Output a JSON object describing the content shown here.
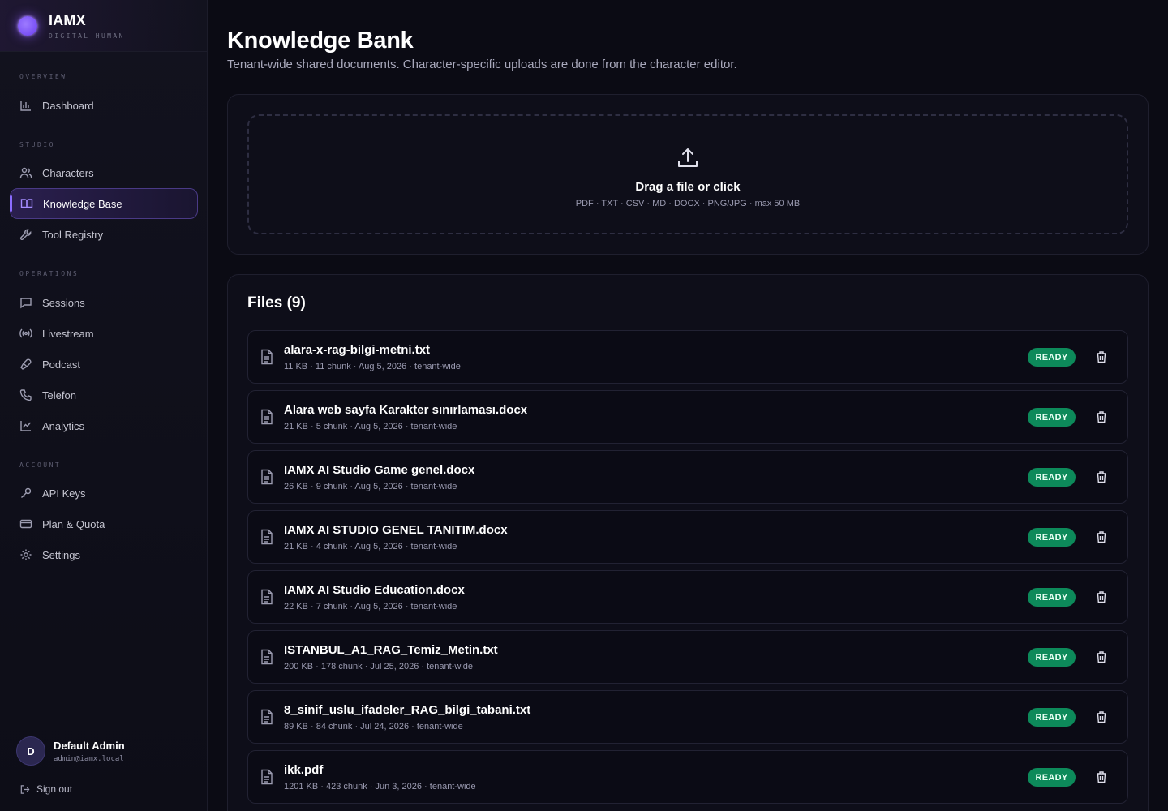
{
  "brand": {
    "name": "IAMX",
    "tagline": "DIGITAL HUMAN"
  },
  "nav": {
    "overview": "OVERVIEW",
    "studio": "STUDIO",
    "operations": "OPERATIONS",
    "account": "ACCOUNT",
    "items": {
      "dashboard": {
        "label": "Dashboard",
        "icon": "bar-chart-icon"
      },
      "characters": {
        "label": "Characters",
        "icon": "users-icon"
      },
      "knowledge_base": {
        "label": "Knowledge Base",
        "icon": "book-icon",
        "active": true
      },
      "tool_registry": {
        "label": "Tool Registry",
        "icon": "wrench-icon"
      },
      "sessions": {
        "label": "Sessions",
        "icon": "chat-icon"
      },
      "livestream": {
        "label": "Livestream",
        "icon": "broadcast-icon"
      },
      "podcast": {
        "label": "Podcast",
        "icon": "microphone-icon"
      },
      "telefon": {
        "label": "Telefon",
        "icon": "phone-icon"
      },
      "analytics": {
        "label": "Analytics",
        "icon": "line-chart-icon"
      },
      "api_keys": {
        "label": "API Keys",
        "icon": "key-icon"
      },
      "plan_quota": {
        "label": "Plan & Quota",
        "icon": "credit-card-icon"
      },
      "settings": {
        "label": "Settings",
        "icon": "gear-icon"
      }
    }
  },
  "user": {
    "initial": "D",
    "name": "Default Admin",
    "email": "admin@iamx.local",
    "signout": "Sign out"
  },
  "page": {
    "title": "Knowledge Bank",
    "subtitle": "Tenant-wide shared documents. Character-specific uploads are done from the character editor."
  },
  "upload": {
    "title": "Drag a file or click",
    "hint": "PDF · TXT · CSV · MD · DOCX · PNG/JPG · max 50 MB"
  },
  "files": {
    "title": "Files (9)",
    "status_label": "READY",
    "items": [
      {
        "name": "alara-x-rag-bilgi-metni.txt",
        "meta": "11 KB · 11 chunk · Aug 5, 2026 · tenant-wide"
      },
      {
        "name": "Alara web sayfa Karakter sınırlaması.docx",
        "meta": "21 KB · 5 chunk · Aug 5, 2026 · tenant-wide"
      },
      {
        "name": "IAMX AI Studio Game genel.docx",
        "meta": "26 KB · 9 chunk · Aug 5, 2026 · tenant-wide"
      },
      {
        "name": "IAMX AI STUDIO GENEL TANITIM.docx",
        "meta": "21 KB · 4 chunk · Aug 5, 2026 · tenant-wide"
      },
      {
        "name": "IAMX AI Studio Education.docx",
        "meta": "22 KB · 7 chunk · Aug 5, 2026 · tenant-wide"
      },
      {
        "name": "ISTANBUL_A1_RAG_Temiz_Metin.txt",
        "meta": "200 KB · 178 chunk · Jul 25, 2026 · tenant-wide"
      },
      {
        "name": "8_sinif_uslu_ifadeler_RAG_bilgi_tabani.txt",
        "meta": "89 KB · 84 chunk · Jul 24, 2026 · tenant-wide"
      },
      {
        "name": "ikk.pdf",
        "meta": "1201 KB · 423 chunk · Jun 3, 2026 · tenant-wide"
      }
    ]
  },
  "colors": {
    "accent": "#8b6cff",
    "ready": "#0d8a5a",
    "background": "#0b0b14"
  }
}
